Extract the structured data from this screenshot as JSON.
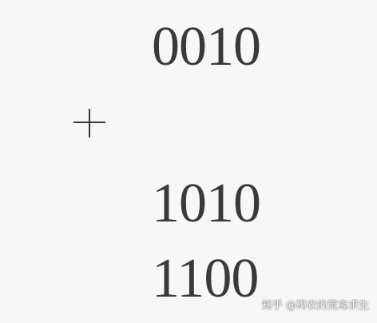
{
  "rows": {
    "first": "0010",
    "second": "1010",
    "result": "1100"
  },
  "operator": {
    "symbol": "+",
    "icon": "plus-icon"
  },
  "watermark": {
    "text": "知乎 @码农的荒岛求生"
  },
  "colors": {
    "background": "#f7f7f7",
    "text": "#3a3a3a"
  }
}
